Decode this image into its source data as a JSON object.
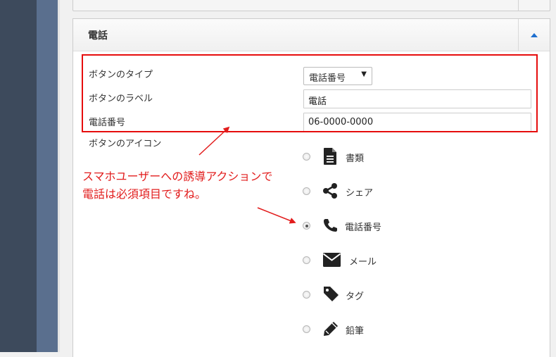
{
  "panel": {
    "title": "電話"
  },
  "form": {
    "button_type_label": "ボタンのタイプ",
    "button_type_value": "電話番号",
    "button_label_label": "ボタンのラベル",
    "button_label_value": "電話",
    "phone_label": "電話番号",
    "phone_value": "06-0000-0000",
    "icon_label": "ボタンのアイコン"
  },
  "icon_options": [
    {
      "label": "書類",
      "icon": "document-icon",
      "checked": false
    },
    {
      "label": "シェア",
      "icon": "share-icon",
      "checked": false
    },
    {
      "label": "電話番号",
      "icon": "phone-icon",
      "checked": true
    },
    {
      "label": "メール",
      "icon": "mail-icon",
      "checked": false
    },
    {
      "label": "タグ",
      "icon": "tag-icon",
      "checked": false
    },
    {
      "label": "鉛筆",
      "icon": "pencil-icon",
      "checked": false
    }
  ],
  "annotation": {
    "line1": "スマホユーザーへの誘導アクションで",
    "line2": "電話は必須項目ですね。",
    "color": "#e21c1c"
  }
}
